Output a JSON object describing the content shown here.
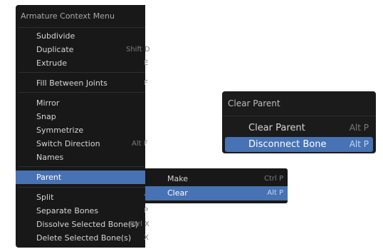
{
  "main_menu": {
    "title": "Armature Context Menu",
    "items": [
      {
        "label": "Subdivide",
        "shortcut": ""
      },
      {
        "label": "Duplicate",
        "shortcut": "Shift D"
      },
      {
        "label": "Extrude",
        "shortcut": "E"
      },
      {
        "label": "Fill Between Joints",
        "shortcut": "F"
      },
      {
        "label": "Mirror",
        "shortcut": ""
      },
      {
        "label": "Snap",
        "shortcut": ""
      },
      {
        "label": "Symmetrize",
        "shortcut": ""
      },
      {
        "label": "Switch Direction",
        "shortcut": "Alt F"
      },
      {
        "label": "Names",
        "shortcut": ""
      },
      {
        "label": "Parent",
        "shortcut": ""
      },
      {
        "label": "Split",
        "shortcut": "Y"
      },
      {
        "label": "Separate Bones",
        "shortcut": "P"
      },
      {
        "label": "Dissolve Selected Bone(s)",
        "shortcut": "Ctrl X"
      },
      {
        "label": "Delete Selected Bone(s)",
        "shortcut": "X"
      }
    ]
  },
  "parent_submenu": {
    "items": [
      {
        "label": "Make",
        "shortcut": "Ctrl P"
      },
      {
        "label": "Clear",
        "shortcut": "Alt P"
      }
    ]
  },
  "clear_parent_menu": {
    "title": "Clear Parent",
    "items": [
      {
        "label": "Clear Parent",
        "shortcut": "Alt P"
      },
      {
        "label": "Disconnect Bone",
        "shortcut": "Alt P"
      }
    ]
  },
  "colors": {
    "menu_background": "#181818",
    "highlight": "#4772b3",
    "text": "#d6d6d6",
    "shortcut_text": "#7c7c7c"
  },
  "icons": [
    "submenu-arrow-icon"
  ]
}
